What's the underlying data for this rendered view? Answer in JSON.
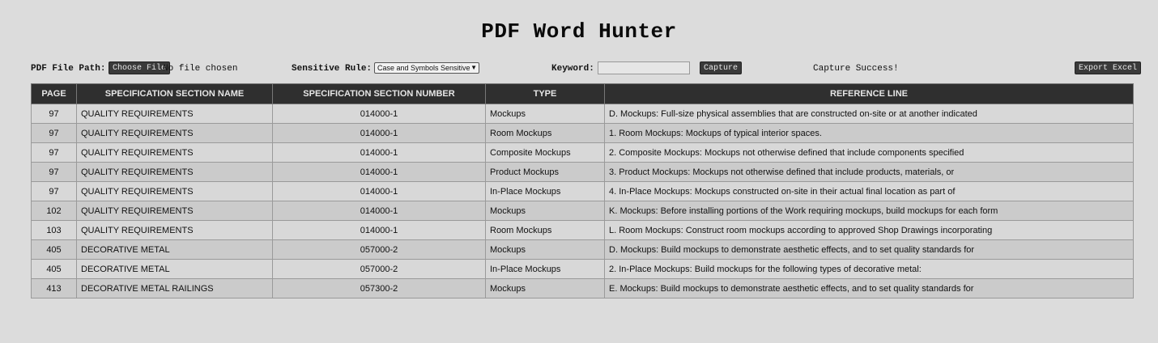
{
  "app": {
    "title": "PDF Word Hunter"
  },
  "toolbar": {
    "file_label": "PDF File Path:",
    "choose_file": "Choose File",
    "no_file": "No file chosen",
    "rule_label": "Sensitive Rule:",
    "rule_value": "Case and Symbols Sensitive",
    "keyword_label": "Keyword:",
    "keyword_value": "",
    "capture_button": "Capture",
    "status": "Capture Success!",
    "export_button": "Export Excel"
  },
  "table": {
    "headers": [
      "PAGE",
      "SPECIFICATION SECTION NAME",
      "SPECIFICATION SECTION NUMBER",
      "TYPE",
      "REFERENCE LINE"
    ],
    "rows": [
      {
        "page": "97",
        "name": "QUALITY REQUIREMENTS",
        "number": "014000-1",
        "type": "Mockups",
        "ref": "D. Mockups: Full-size physical assemblies that are constructed on-site or at another indicated"
      },
      {
        "page": "97",
        "name": "QUALITY REQUIREMENTS",
        "number": "014000-1",
        "type": "Room Mockups",
        "ref": "1. Room Mockups: Mockups of typical interior spaces."
      },
      {
        "page": "97",
        "name": "QUALITY REQUIREMENTS",
        "number": "014000-1",
        "type": "Composite Mockups",
        "ref": "2. Composite Mockups: Mockups not otherwise defined that include components specified"
      },
      {
        "page": "97",
        "name": "QUALITY REQUIREMENTS",
        "number": "014000-1",
        "type": "Product Mockups",
        "ref": "3. Product Mockups: Mockups not otherwise defined that include products, materials, or"
      },
      {
        "page": "97",
        "name": "QUALITY REQUIREMENTS",
        "number": "014000-1",
        "type": "In-Place Mockups",
        "ref": "4. In-Place Mockups: Mockups constructed on-site in their actual final location as part of"
      },
      {
        "page": "102",
        "name": "QUALITY REQUIREMENTS",
        "number": "014000-1",
        "type": "Mockups",
        "ref": "K. Mockups: Before installing portions of the Work requiring mockups, build mockups for each form"
      },
      {
        "page": "103",
        "name": "QUALITY REQUIREMENTS",
        "number": "014000-1",
        "type": "Room Mockups",
        "ref": "L. Room Mockups: Construct room mockups according to approved Shop Drawings incorporating"
      },
      {
        "page": "405",
        "name": "DECORATIVE METAL",
        "number": "057000-2",
        "type": "Mockups",
        "ref": "D. Mockups: Build mockups to demonstrate aesthetic effects, and to set quality standards for"
      },
      {
        "page": "405",
        "name": "DECORATIVE METAL",
        "number": "057000-2",
        "type": "In-Place Mockups",
        "ref": "2. In-Place Mockups: Build mockups for the following types of decorative metal:"
      },
      {
        "page": "413",
        "name": "DECORATIVE METAL RAILINGS",
        "number": "057300-2",
        "type": "Mockups",
        "ref": "E. Mockups: Build mockups to demonstrate aesthetic effects, and to set quality standards for"
      }
    ]
  }
}
